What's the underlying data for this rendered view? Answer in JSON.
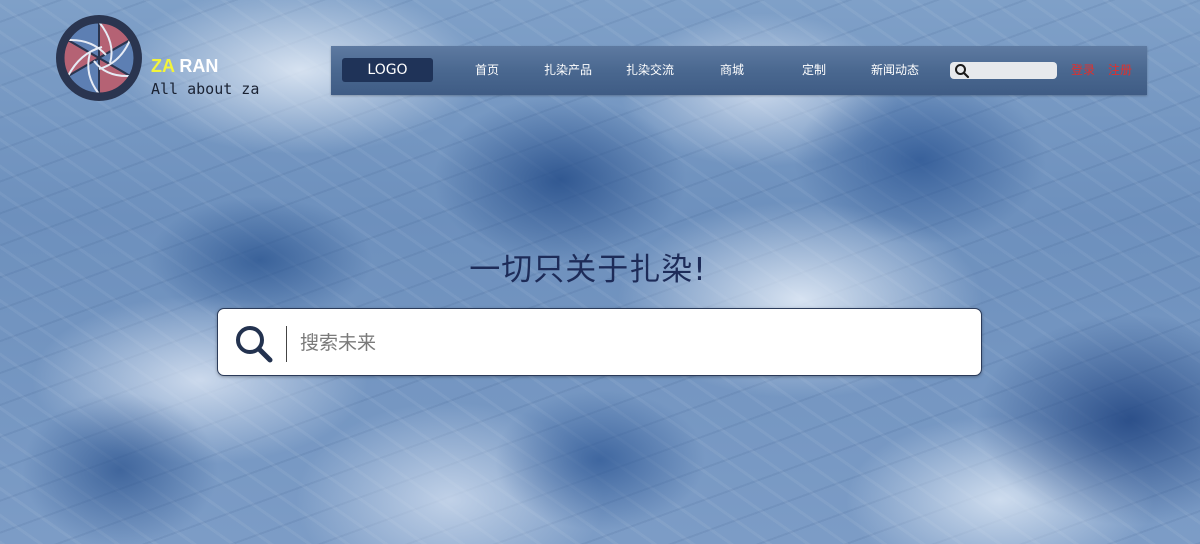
{
  "brand": {
    "za": "ZA",
    "ran": "RAN",
    "tagline": "All about za"
  },
  "nav": {
    "logo_label": "LOGO",
    "items": [
      "首页",
      "扎染产品",
      "扎染交流",
      "商城",
      "定制",
      "新闻动态"
    ],
    "login_label": "登录",
    "register_label": "注册"
  },
  "hero": {
    "slogan": "一切只关于扎染!",
    "search_placeholder": "搜索未来"
  },
  "icons": {
    "logo": "camera-aperture-icon",
    "nav_search": "search-icon",
    "hero_search": "search-icon"
  },
  "colors": {
    "nav_bg": "#4a6890",
    "nav_logo_bg": "#1f3358",
    "auth_link": "#e1302d",
    "brand_za": "#f2f43a",
    "slogan": "#1d2b58"
  }
}
